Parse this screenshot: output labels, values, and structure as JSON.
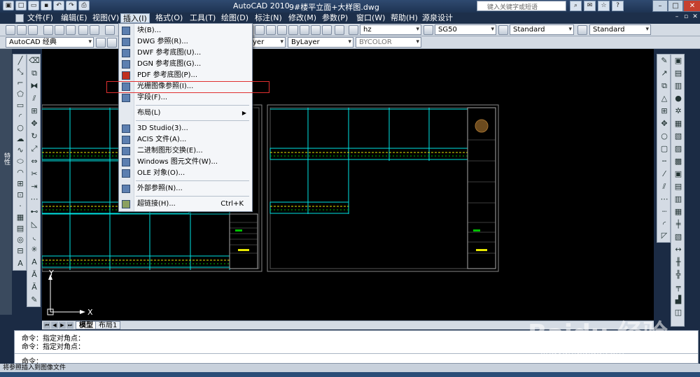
{
  "window": {
    "app_title": "AutoCAD 2010",
    "doc_title": "9#楼平立面+大样图.dwg",
    "search_placeholder": "键入关键字或短语"
  },
  "menubar": {
    "items": [
      "文件(F)",
      "编辑(E)",
      "视图(V)",
      "插入(I)",
      "格式(O)",
      "工具(T)",
      "绘图(D)",
      "标注(N)",
      "修改(M)",
      "参数(P)",
      "窗口(W)",
      "帮助(H)",
      "源泉设计"
    ],
    "active": "插入(I)"
  },
  "toolbar": {
    "text_style": "hz",
    "dim_style": "SG50",
    "table_style": "Standard",
    "multileader_style": "Standard",
    "workspace": "AutoCAD 经典",
    "layer_linetype_partial": "yer",
    "linetype": "ByLayer",
    "plot_style": "BYCOLOR"
  },
  "insert_menu": {
    "items": [
      {
        "label": "块(B)...",
        "shortcut": ""
      },
      {
        "label": "DWG 参照(R)...",
        "shortcut": ""
      },
      {
        "label": "DWF 参考底图(U)...",
        "shortcut": ""
      },
      {
        "label": "DGN 参考底图(G)...",
        "shortcut": ""
      },
      {
        "label": "PDF 参考底图(P)...",
        "shortcut": ""
      },
      {
        "label": "光栅图像参照(I)...",
        "shortcut": ""
      },
      {
        "label": "字段(F)...",
        "shortcut": ""
      },
      {
        "label": "布局(L)",
        "shortcut": ""
      },
      {
        "label": "3D Studio(3)...",
        "shortcut": ""
      },
      {
        "label": "ACIS 文件(A)...",
        "shortcut": ""
      },
      {
        "label": "二进制图形交换(E)...",
        "shortcut": ""
      },
      {
        "label": "Windows 图元文件(W)...",
        "shortcut": ""
      },
      {
        "label": "OLE 对象(O)...",
        "shortcut": ""
      },
      {
        "label": "外部参照(N)...",
        "shortcut": ""
      },
      {
        "label": "超链接(H)...",
        "shortcut": "Ctrl+K"
      }
    ],
    "highlighted": "光栅图像参照(I)..."
  },
  "tabs": {
    "items": [
      "模型",
      "布局1"
    ],
    "active": "模型"
  },
  "ucs": {
    "x": "X",
    "y": "Y"
  },
  "cmdline": {
    "lines": [
      "命令：指定对角点：",
      "命令：指定对角点："
    ],
    "prompt": "命令："
  },
  "left_dock_label": "特性",
  "statusbar": {
    "text": "将参照插入到图像文件"
  },
  "watermark": {
    "brand": "Baidu 经验",
    "url": "jingyan.baidu.com"
  },
  "colors": {
    "canvas": "#000000",
    "cyan_lines": "#00e5e5",
    "yellow_text": "#e8e800",
    "green_text": "#00c000",
    "highlight_box": "#e03030"
  }
}
